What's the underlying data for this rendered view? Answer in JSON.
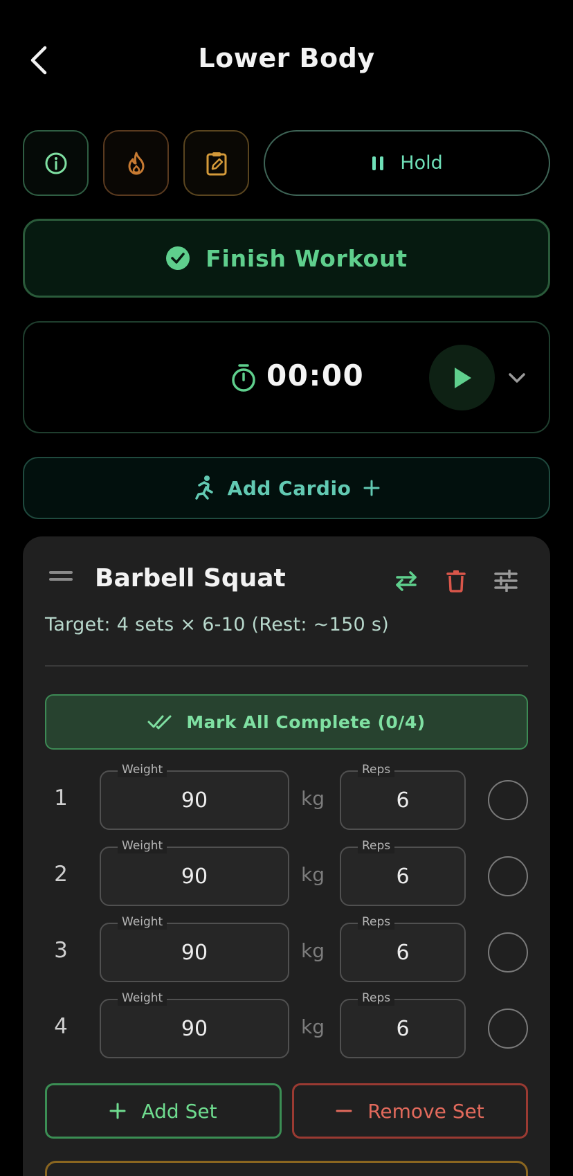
{
  "header": {
    "title": "Lower Body"
  },
  "toolbar": {
    "hold_label": "Hold"
  },
  "finish": {
    "label": "Finish Workout"
  },
  "timer": {
    "value": "00:00"
  },
  "cardio": {
    "label": "Add Cardio"
  },
  "exercise": {
    "name": "Barbell Squat",
    "target": "Target: 4 sets × 6-10 (Rest: ~150 s)",
    "mark_all_label": "Mark All Complete (0/4)",
    "weight_label": "Weight",
    "reps_label": "Reps",
    "unit": "kg",
    "sets": [
      {
        "number": "1",
        "weight": "90",
        "reps": "6",
        "completed": false
      },
      {
        "number": "2",
        "weight": "90",
        "reps": "6",
        "completed": false
      },
      {
        "number": "3",
        "weight": "90",
        "reps": "6",
        "completed": false
      },
      {
        "number": "4",
        "weight": "90",
        "reps": "6",
        "completed": false
      }
    ],
    "add_set_label": "Add Set",
    "remove_set_label": "Remove Set"
  },
  "icons": {
    "back": "chevron-left-icon",
    "info": "info-icon",
    "fire": "fire-icon",
    "clipboard": "clipboard-edit-icon",
    "pause": "pause-icon",
    "check_circle": "check-circle-icon",
    "stopwatch": "stopwatch-icon",
    "play": "play-icon",
    "expand": "chevron-down-icon",
    "run": "running-icon",
    "plus": "plus-icon",
    "drag": "drag-handle-icon",
    "swap": "swap-icon",
    "delete": "trash-icon",
    "tune": "tune-icon",
    "double_check": "double-check-icon",
    "minus": "minus-icon"
  },
  "colors": {
    "background": "#000000",
    "card": "#202020",
    "accent_green": "#5fcf8d",
    "accent_teal": "#62c9b2",
    "danger": "#e26a5c",
    "warning": "#8a6620"
  }
}
